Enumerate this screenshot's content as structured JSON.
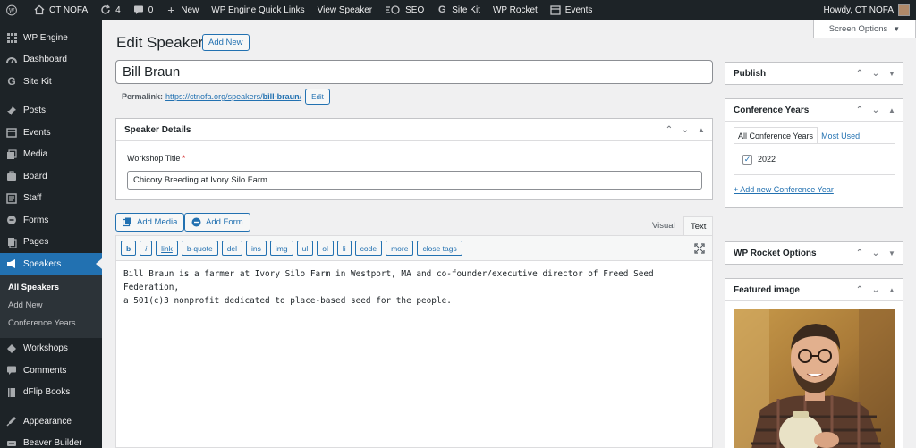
{
  "adminbar": {
    "site_name": "CT NOFA",
    "updates_count": "4",
    "comments_count": "0",
    "new_label": "New",
    "quick_links": "WP Engine Quick Links",
    "view_speaker": "View Speaker",
    "seo": "SEO",
    "site_kit": "Site Kit",
    "wp_rocket": "WP Rocket",
    "events": "Events",
    "howdy": "Howdy, CT NOFA"
  },
  "sidebar": {
    "items": [
      {
        "label": "WP Engine",
        "icon": "wp-engine-icon"
      },
      {
        "label": "Dashboard",
        "icon": "dashboard-icon"
      },
      {
        "label": "Site Kit",
        "icon": "site-kit-icon"
      },
      {
        "label": "Posts",
        "icon": "pin-icon"
      },
      {
        "label": "Events",
        "icon": "calendar-icon"
      },
      {
        "label": "Media",
        "icon": "media-icon"
      },
      {
        "label": "Board",
        "icon": "board-icon"
      },
      {
        "label": "Staff",
        "icon": "staff-icon"
      },
      {
        "label": "Forms",
        "icon": "forms-icon"
      },
      {
        "label": "Pages",
        "icon": "pages-icon"
      },
      {
        "label": "Speakers",
        "icon": "megaphone-icon"
      }
    ],
    "submenu": [
      "All Speakers",
      "Add New",
      "Conference Years"
    ],
    "items_after": [
      {
        "label": "Workshops",
        "icon": "workshops-icon"
      },
      {
        "label": "Comments",
        "icon": "comments-icon"
      },
      {
        "label": "dFlip Books",
        "icon": "book-icon"
      },
      {
        "label": "Appearance",
        "icon": "appearance-icon"
      },
      {
        "label": "Beaver Builder",
        "icon": "beaver-icon"
      }
    ]
  },
  "page": {
    "title": "Edit Speaker",
    "add_new": "Add New",
    "screen_options": "Screen Options"
  },
  "post": {
    "title": "Bill Braun",
    "permalink_label": "Permalink:",
    "permalink_base": "https://ctnofa.org/speakers/",
    "permalink_slug": "bill-braun",
    "permalink_end": "/",
    "edit_label": "Edit"
  },
  "speaker_details": {
    "heading": "Speaker Details",
    "workshop_label": "Workshop Title",
    "required_mark": "*",
    "workshop_value": "Chicory Breeding at Ivory Silo Farm"
  },
  "editor": {
    "add_media": "Add Media",
    "add_form": "Add Form",
    "tab_visual": "Visual",
    "tab_text": "Text",
    "buttons": [
      "b",
      "i",
      "link",
      "b-quote",
      "del",
      "ins",
      "img",
      "ul",
      "ol",
      "li",
      "code",
      "more",
      "close tags"
    ],
    "content_line1": "Bill Braun is a farmer at Ivory Silo Farm in Westport, MA and co-founder/executive director of Freed Seed Federation,",
    "content_line2": "a 501(c)3 nonprofit dedicated to place-based seed for the people."
  },
  "sidebar_boxes": {
    "publish": "Publish",
    "conference_years": "Conference Years",
    "tab_all": "All Conference Years",
    "tab_most_used": "Most Used",
    "year": "2022",
    "add_year": "+ Add new Conference Year",
    "wp_rocket": "WP Rocket Options",
    "featured_image": "Featured image"
  },
  "colors": {
    "accent": "#2271b1",
    "admin_dark": "#1d2327",
    "background": "#f0f0f1"
  }
}
